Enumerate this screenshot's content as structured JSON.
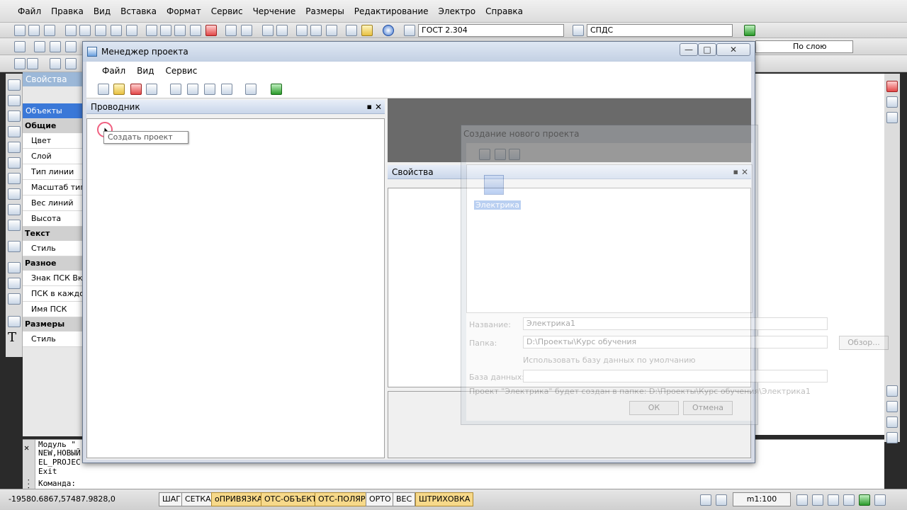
{
  "menubar": {
    "items": [
      "Файл",
      "Правка",
      "Вид",
      "Вставка",
      "Формат",
      "Сервис",
      "Черчение",
      "Размеры",
      "Редактирование",
      "Электро",
      "Справка"
    ]
  },
  "toolbar": {
    "style_combo": "ГОСТ 2.304",
    "dim_combo": "СПДС",
    "layer_combo": "По слою"
  },
  "properties": {
    "title": "Свойства",
    "selected": "Объекты",
    "categories": {
      "general": "Общие",
      "text": "Текст",
      "misc": "Разное",
      "dims": "Размеры"
    },
    "rows": {
      "color": "Цвет",
      "layer": "Слой",
      "linetype": "Тип линии",
      "ltscale": "Масштаб типа",
      "lineweight": "Вес линий",
      "height": "Высота",
      "text_style": "Стиль",
      "ucs_icon": "Знак ПСК Вкл",
      "ucs_each": "ПСК в каждом",
      "ucs_name": "Имя ПСК",
      "dim_style": "Стиль"
    }
  },
  "command": {
    "side_label": "Кома...",
    "lines": [
      "Модуль \"",
      "NEW,НОВЫЙ",
      "EL_PROJEC",
      "Exit"
    ],
    "prompt": "Команда:",
    "behind_text": "Менеджер проекта"
  },
  "status": {
    "coords": "-19580.6867,57487.9828,0",
    "buttons": [
      {
        "label": "ШАГ",
        "on": false
      },
      {
        "label": "СЕТКА",
        "on": false
      },
      {
        "label": "оПРИВЯЗКА",
        "on": true
      },
      {
        "label": "ОТС-ОБЪЕКТ",
        "on": true
      },
      {
        "label": "ОТС-ПОЛЯР",
        "on": true
      },
      {
        "label": "ОРТО",
        "on": false
      },
      {
        "label": "ВЕС",
        "on": false
      },
      {
        "label": "ШТРИХОВКА",
        "on": true
      }
    ],
    "scale": "m1:100"
  },
  "project_manager": {
    "title": "Менеджер проекта",
    "menu": [
      "Файл",
      "Вид",
      "Сервис"
    ],
    "explorer_title": "Проводник",
    "tooltip": "Создать проект",
    "properties_title": "Свойства",
    "min": "—",
    "max": "□",
    "close": "✕"
  },
  "new_project_dialog": {
    "title": "Создание нового проекта",
    "item": "Электрика",
    "name_label": "Название:",
    "name_value": "Электрика1",
    "path_label": "Папка:",
    "path_value": "D:\\Проекты\\Курс обучения",
    "browse": "Обзор...",
    "default_db": "Использовать базу данных по умолчанию",
    "db_label": "База данных:",
    "note": "Проект \"Электрика\" будет создан в папке: D:\\Проекты\\Курс обучения\\Электрика1",
    "ok": "ОК",
    "cancel": "Отмена"
  }
}
